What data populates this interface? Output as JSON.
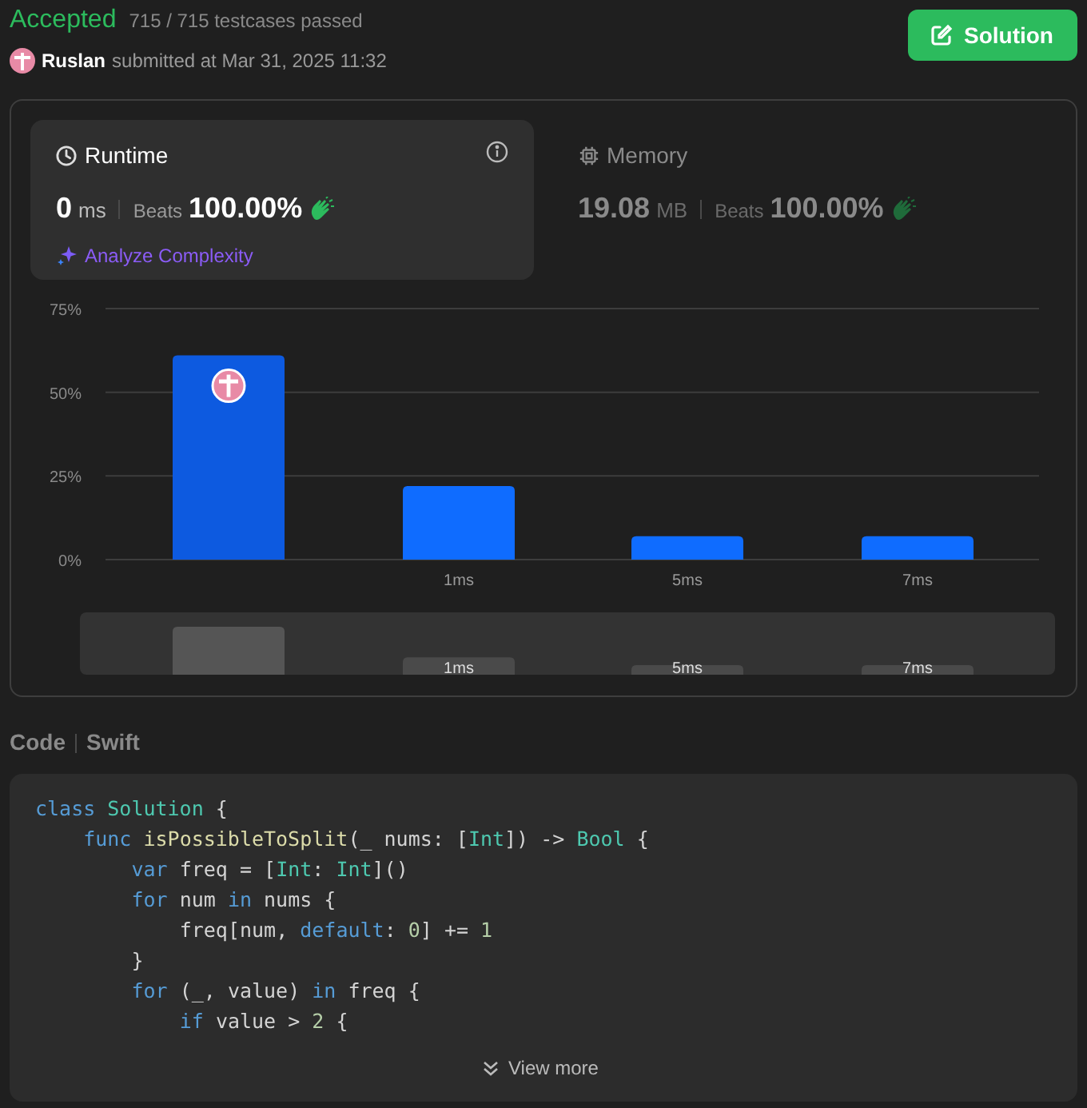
{
  "status": "Accepted",
  "testcases": "715 / 715 testcases passed",
  "author": "Ruslan",
  "submitted": "submitted at Mar 31, 2025 11:32",
  "solution_button": "Solution",
  "metrics": [
    {
      "kind": "runtime",
      "title": "Runtime",
      "selected": true,
      "value": "0",
      "unit": "ms",
      "beats_label": "Beats",
      "beats": "100.00%",
      "action": "Analyze Complexity"
    },
    {
      "kind": "memory",
      "title": "Memory",
      "selected": false,
      "value": "19.08",
      "unit": "MB",
      "beats_label": "Beats",
      "beats": "100.00%"
    }
  ],
  "chart": {
    "chart_data": {
      "type": "bar",
      "categories": [
        null,
        "1ms",
        "5ms",
        "7ms"
      ],
      "values": [
        61,
        22,
        7,
        7
      ],
      "ylim": [
        0,
        75
      ],
      "yticks": [
        {
          "value": 0,
          "label": "0%"
        },
        {
          "value": 25,
          "label": "25%"
        },
        {
          "value": 50,
          "label": "50%"
        },
        {
          "value": 75,
          "label": "75%"
        }
      ]
    },
    "user_marker": [
      true,
      false,
      false,
      false
    ],
    "overview_labels": [
      "1ms",
      "5ms",
      "7ms"
    ]
  },
  "code_section": {
    "label": "Code",
    "language": "Swift"
  },
  "code_lines": [
    {
      "tokens": [
        {
          "kind": "kw",
          "text": "class "
        },
        {
          "kind": "type",
          "text": "Solution"
        },
        {
          "kind": "plain",
          "text": " {"
        }
      ],
      "children": [
        {
          "tokens": [
            {
              "kind": "kw",
              "text": "func "
            },
            {
              "kind": "fn",
              "text": "isPossibleToSplit"
            },
            {
              "kind": "plain",
              "text": "(_ nums: ["
            },
            {
              "kind": "type",
              "text": "Int"
            },
            {
              "kind": "plain",
              "text": "]) -> "
            },
            {
              "kind": "type",
              "text": "Bool"
            },
            {
              "kind": "plain",
              "text": " {"
            }
          ],
          "children": [
            {
              "tokens": [
                {
                  "kind": "kw",
                  "text": "var "
                },
                {
                  "kind": "plain",
                  "text": "freq = ["
                },
                {
                  "kind": "type",
                  "text": "Int"
                },
                {
                  "kind": "plain",
                  "text": ": "
                },
                {
                  "kind": "type",
                  "text": "Int"
                },
                {
                  "kind": "plain",
                  "text": "]()"
                }
              ]
            },
            {
              "tokens": [
                {
                  "kind": "kw",
                  "text": "for "
                },
                {
                  "kind": "plain",
                  "text": "num "
                },
                {
                  "kind": "kw",
                  "text": "in "
                },
                {
                  "kind": "plain",
                  "text": "nums {"
                }
              ],
              "children": [
                {
                  "tokens": [
                    {
                      "kind": "plain",
                      "text": "freq[num, "
                    },
                    {
                      "kind": "kw",
                      "text": "default"
                    },
                    {
                      "kind": "plain",
                      "text": ": "
                    },
                    {
                      "kind": "num",
                      "text": "0"
                    },
                    {
                      "kind": "plain",
                      "text": "] += "
                    },
                    {
                      "kind": "num",
                      "text": "1"
                    }
                  ]
                }
              ]
            },
            {
              "tokens": [
                {
                  "kind": "plain",
                  "text": "}"
                }
              ]
            },
            {
              "tokens": [
                {
                  "kind": "kw",
                  "text": "for "
                },
                {
                  "kind": "plain",
                  "text": "(_, value) "
                },
                {
                  "kind": "kw",
                  "text": "in "
                },
                {
                  "kind": "plain",
                  "text": "freq {"
                }
              ],
              "children": [
                {
                  "tokens": [
                    {
                      "kind": "kw",
                      "text": "if "
                    },
                    {
                      "kind": "plain",
                      "text": "value > "
                    },
                    {
                      "kind": "num",
                      "text": "2"
                    },
                    {
                      "kind": "plain",
                      "text": " {"
                    }
                  ]
                }
              ]
            }
          ]
        }
      ]
    }
  ],
  "view_more": "View more"
}
